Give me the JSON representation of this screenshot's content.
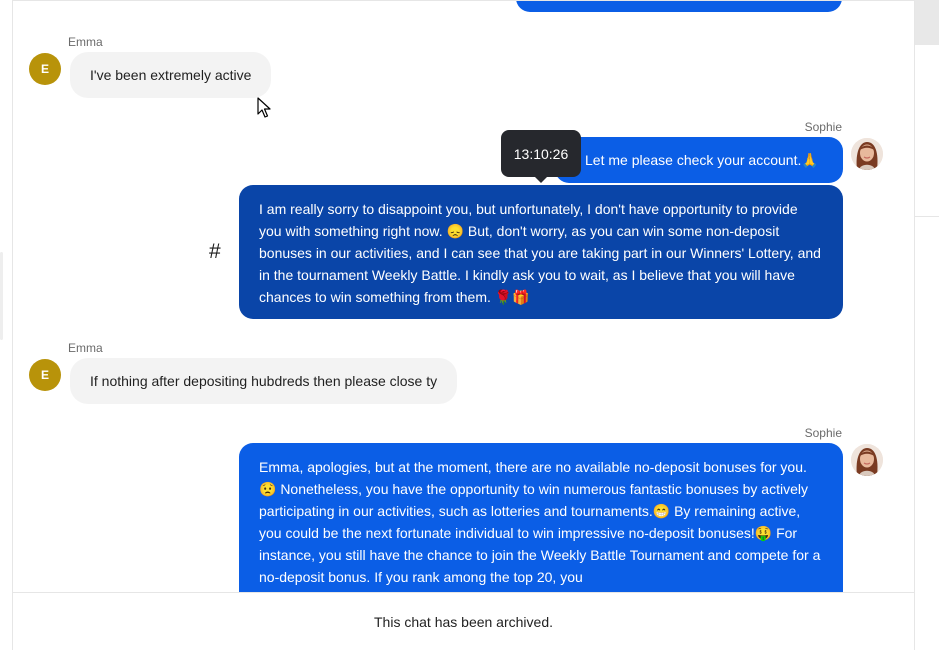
{
  "messages": [
    {
      "sender": "Emma",
      "avatar_letter": "E",
      "text": "I've been extremely active"
    },
    {
      "sender": "Sophie",
      "text": "Let me please check your account.🙏"
    },
    {
      "text": "I am really sorry to disappoint you, but unfortunately, I don't have opportunity to provide you with something right now. 😞 But, don't worry, as you can win some non-deposit bonuses in our activities, and I can see that you are taking part in our Winners' Lottery, and in the tournament Weekly Battle. I kindly ask you to wait, as I believe that you will have chances to win something from them. 🌹🎁"
    },
    {
      "sender": "Emma",
      "avatar_letter": "E",
      "text": "If nothing after depositing hubdreds then please close ty"
    },
    {
      "sender": "Sophie",
      "text": "Emma, apologies, but at the moment, there are no available no-deposit bonuses for you.😟 Nonetheless, you have the opportunity to win numerous fantastic bonuses by actively participating in our activities, such as lotteries and tournaments.😁 By remaining active, you could be the next fortunate individual to win impressive no-deposit bonuses!🤑 For instance, you still have the chance to join the Weekly Battle Tournament and compete for a no-deposit bonus. If you rank among the top 20, you"
    }
  ],
  "tooltip": {
    "time": "13:10:26"
  },
  "hash_symbol": "#",
  "footer": {
    "archived_text": "This chat has been archived."
  },
  "colors": {
    "outgoing": "#0b5ee6",
    "outgoing_selected": "#0a45a8",
    "incoming": "#f3f3f3",
    "avatar_emma": "#b8930a"
  },
  "icons": {
    "cursor": "arrow-cursor-icon",
    "sophie_avatar": "avatar-photo"
  }
}
